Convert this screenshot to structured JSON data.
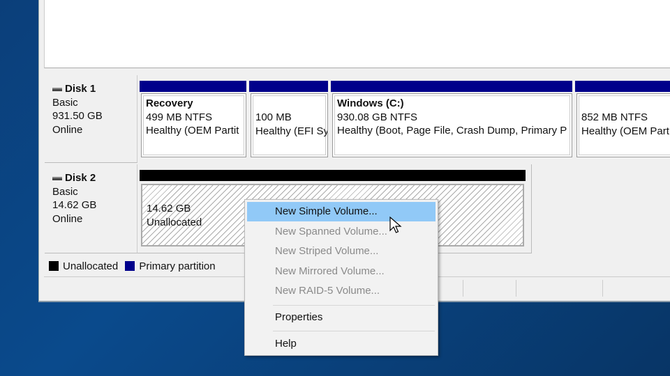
{
  "disks": [
    {
      "name": "Disk 1",
      "type": "Basic",
      "size": "931.50 GB",
      "status": "Online",
      "partitions": [
        {
          "name": "Recovery",
          "size": "499 MB NTFS",
          "status": "Healthy (OEM Partit"
        },
        {
          "name": "",
          "size": "100 MB",
          "status": "Healthy (EFI Sy"
        },
        {
          "name": "Windows  (C:)",
          "size": "930.08 GB NTFS",
          "status": "Healthy (Boot, Page File, Crash Dump, Primary P"
        },
        {
          "name": "",
          "size": "852 MB NTFS",
          "status": "Healthy (OEM Part"
        }
      ]
    },
    {
      "name": "Disk 2",
      "type": "Basic",
      "size": "14.62 GB",
      "status": "Online",
      "partitions": [
        {
          "size": "14.62 GB",
          "status": "Unallocated"
        }
      ]
    }
  ],
  "legend": [
    {
      "label": "Unallocated",
      "color": "#000000"
    },
    {
      "label": "Primary partition",
      "color": "#00008b"
    }
  ],
  "context_menu": {
    "items": [
      {
        "label": "New Simple Volume...",
        "enabled": true,
        "highlighted": true
      },
      {
        "label": "New Spanned Volume...",
        "enabled": false
      },
      {
        "label": "New Striped Volume...",
        "enabled": false
      },
      {
        "label": "New Mirrored Volume...",
        "enabled": false
      },
      {
        "label": "New RAID-5 Volume...",
        "enabled": false
      },
      {
        "label": "Properties",
        "enabled": true
      },
      {
        "label": "Help",
        "enabled": true
      }
    ]
  },
  "colors": {
    "primary": "#00008b",
    "unallocated": "#000000",
    "highlight": "#91c9f7"
  }
}
